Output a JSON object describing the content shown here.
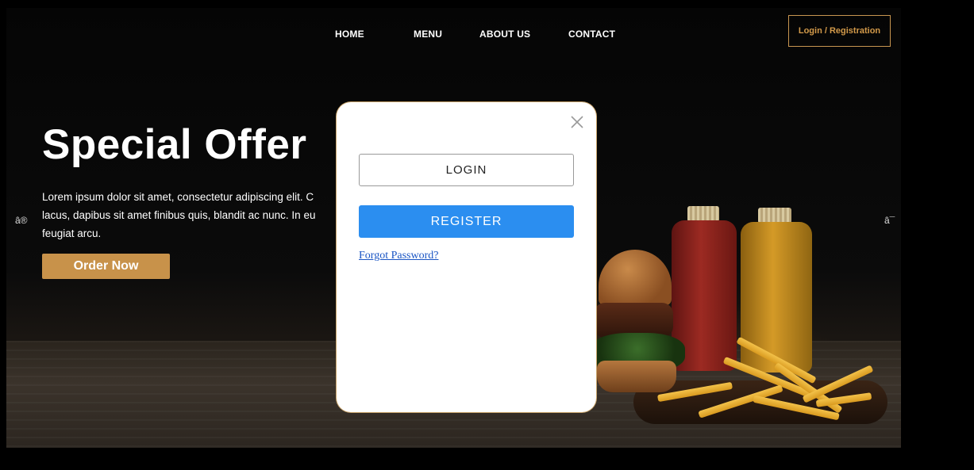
{
  "nav": {
    "items": [
      "HOME",
      "MENU",
      "ABOUT US",
      "CONTACT"
    ],
    "login_label": "Login / Registration"
  },
  "hero": {
    "headline": "Special Offer",
    "text": "Lorem ipsum dolor sit amet, consectetur adipiscing elit. C lacus, dapibus sit amet finibus quis, blandit ac nunc. In eu feugiat arcu.",
    "order_label": "Order Now",
    "prev_arrow": "â®",
    "next_arrow": "â¯"
  },
  "modal": {
    "close_icon": "close-icon",
    "login_label": "LOGIN",
    "register_label": "REGISTER",
    "forgot_label": "Forgot Password?"
  },
  "colors": {
    "accent": "#c8924a",
    "register_blue": "#2b8ef0",
    "link": "#1a55c4"
  }
}
